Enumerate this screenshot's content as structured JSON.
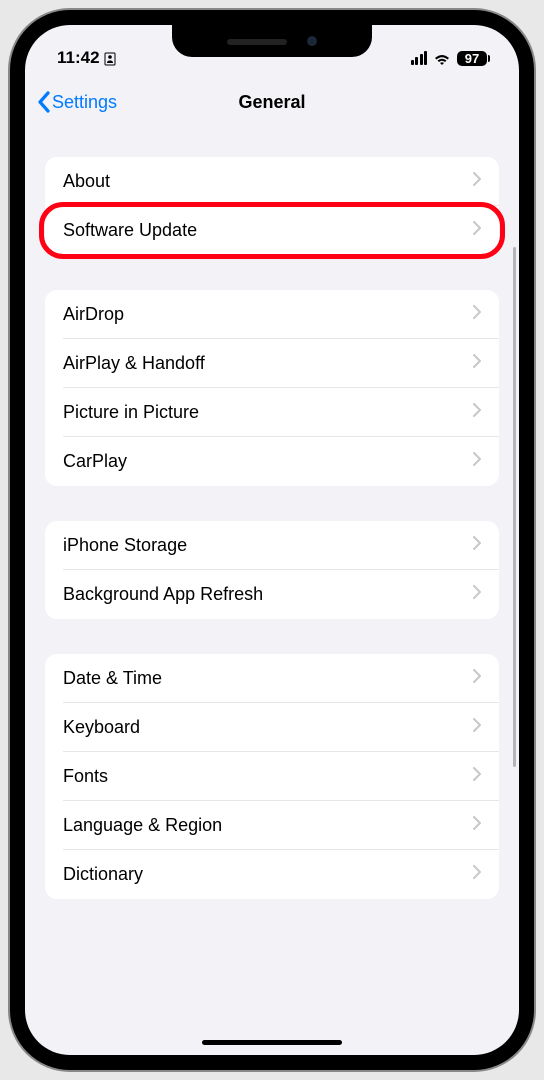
{
  "statusBar": {
    "time": "11:42",
    "batteryPercent": "97"
  },
  "nav": {
    "backLabel": "Settings",
    "title": "General"
  },
  "sections": [
    {
      "rows": [
        {
          "label": "About",
          "highlighted": false
        },
        {
          "label": "Software Update",
          "highlighted": true
        }
      ]
    },
    {
      "rows": [
        {
          "label": "AirDrop",
          "highlighted": false
        },
        {
          "label": "AirPlay & Handoff",
          "highlighted": false
        },
        {
          "label": "Picture in Picture",
          "highlighted": false
        },
        {
          "label": "CarPlay",
          "highlighted": false
        }
      ]
    },
    {
      "rows": [
        {
          "label": "iPhone Storage",
          "highlighted": false
        },
        {
          "label": "Background App Refresh",
          "highlighted": false
        }
      ]
    },
    {
      "rows": [
        {
          "label": "Date & Time",
          "highlighted": false
        },
        {
          "label": "Keyboard",
          "highlighted": false
        },
        {
          "label": "Fonts",
          "highlighted": false
        },
        {
          "label": "Language & Region",
          "highlighted": false
        },
        {
          "label": "Dictionary",
          "highlighted": false
        }
      ]
    }
  ]
}
